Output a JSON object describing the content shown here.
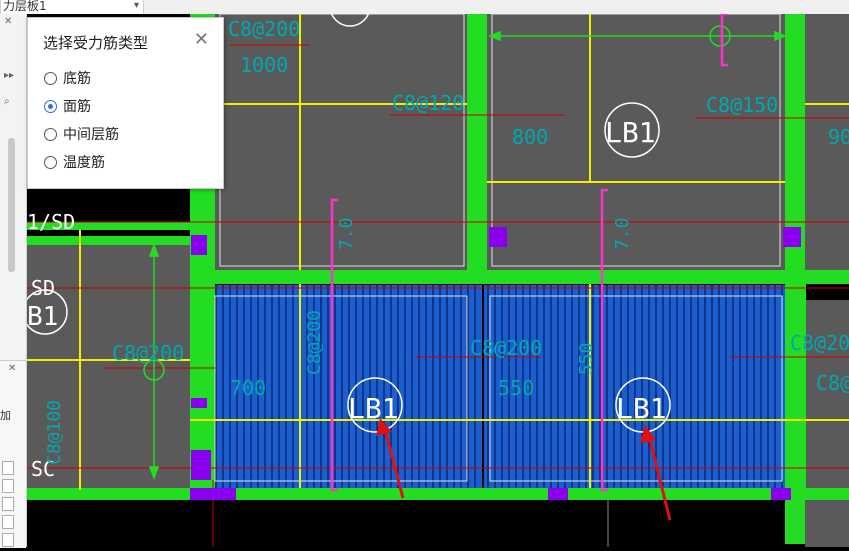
{
  "layer_selector": {
    "value": "力层板1"
  },
  "dialog": {
    "title": "选择受力筋类型",
    "options": [
      {
        "label": "底筋",
        "selected": false
      },
      {
        "label": "面筋",
        "selected": true
      },
      {
        "label": "中间层筋",
        "selected": false
      },
      {
        "label": "温度筋",
        "selected": false
      }
    ]
  },
  "cad": {
    "axis_labels": [
      "1/SD",
      "SD",
      "SC"
    ],
    "slab_labels": [
      "LB1",
      "LB1",
      "LB1",
      "B1"
    ],
    "rebar_texts": [
      "C8@200",
      "1000",
      "C8@120",
      "800",
      "C8@150",
      "90",
      "C8@200",
      "700",
      "C8@200",
      "C8@200",
      "550",
      "C8@200",
      "C8@200",
      "550",
      "C8@100"
    ],
    "dim_text": "7.0"
  },
  "colors": {
    "beam": "#22dd22",
    "slab_fill": "#5a5a5a",
    "rebar_fill": "#1a5fd0",
    "yellow": "#f0f000",
    "magenta": "#ff33cc",
    "red_line": "#cc0000",
    "cyan_text": "#00a8b0"
  }
}
